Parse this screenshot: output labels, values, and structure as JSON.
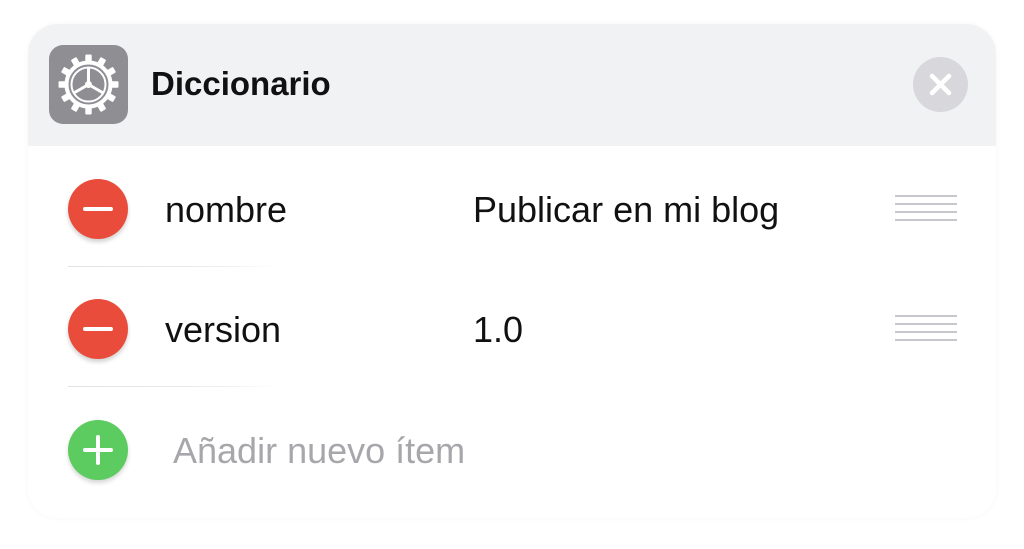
{
  "header": {
    "title": "Diccionario",
    "icon": "gear-icon",
    "close_icon": "close-icon"
  },
  "rows": [
    {
      "key": "nombre",
      "value": "Publicar en mi blog",
      "remove_icon": "minus-circle-icon",
      "handle_icon": "drag-handle-icon"
    },
    {
      "key": "version",
      "value": "1.0",
      "remove_icon": "minus-circle-icon",
      "handle_icon": "drag-handle-icon"
    }
  ],
  "add_item": {
    "label": "Añadir nuevo ítem",
    "icon": "plus-circle-icon"
  },
  "colors": {
    "header_bg": "#f1f2f4",
    "remove": "#ea4c3c",
    "add": "#5ccc61",
    "icon_bg": "#8e8e93",
    "placeholder": "#a7a7ab"
  }
}
